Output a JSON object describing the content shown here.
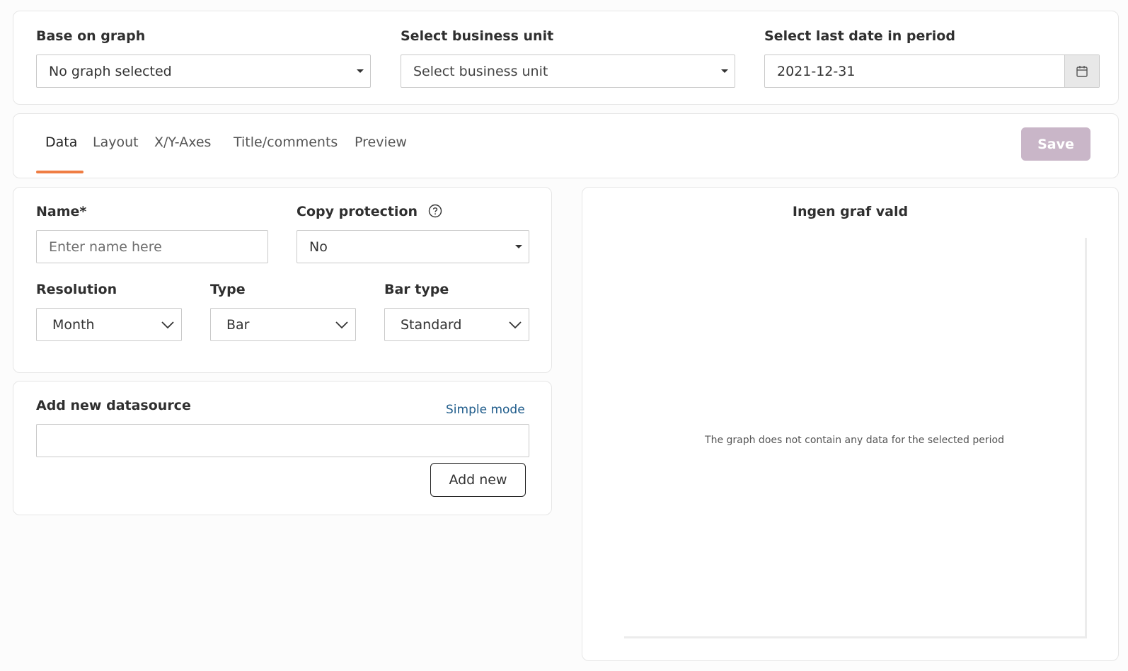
{
  "filters": {
    "base_graph": {
      "label": "Base on graph",
      "value": "No graph selected"
    },
    "business_unit": {
      "label": "Select business unit",
      "placeholder": "Select business unit"
    },
    "last_date": {
      "label": "Select last date in period",
      "value": "2021-12-31"
    }
  },
  "tabs": [
    {
      "label": "Data",
      "active": true
    },
    {
      "label": "Layout",
      "active": false
    },
    {
      "label": "X/Y-Axes",
      "active": false
    },
    {
      "label": "Title/comments",
      "active": false
    },
    {
      "label": "Preview",
      "active": false
    }
  ],
  "save_label": "Save",
  "form": {
    "name": {
      "label": "Name*",
      "placeholder": "Enter name here",
      "value": ""
    },
    "copy_protection": {
      "label": "Copy protection",
      "value": "No"
    },
    "resolution": {
      "label": "Resolution",
      "value": "Month"
    },
    "type": {
      "label": "Type",
      "value": "Bar"
    },
    "bar_type": {
      "label": "Bar type",
      "value": "Standard"
    }
  },
  "datasource": {
    "label": "Add new datasource",
    "mode_link": "Simple mode",
    "value": "",
    "add_label": "Add new"
  },
  "preview": {
    "title": "Ingen graf vald",
    "empty_message": "The graph does not contain any data for the selected period"
  },
  "colors": {
    "accent": "#ef7d43",
    "save_disabled": "#c9b6c8",
    "link": "#1f5c8b"
  },
  "icons": {
    "calendar": "calendar-icon",
    "help": "help-circle-icon",
    "dropdown": "caret-down-icon",
    "chevron": "chevron-down-icon"
  }
}
